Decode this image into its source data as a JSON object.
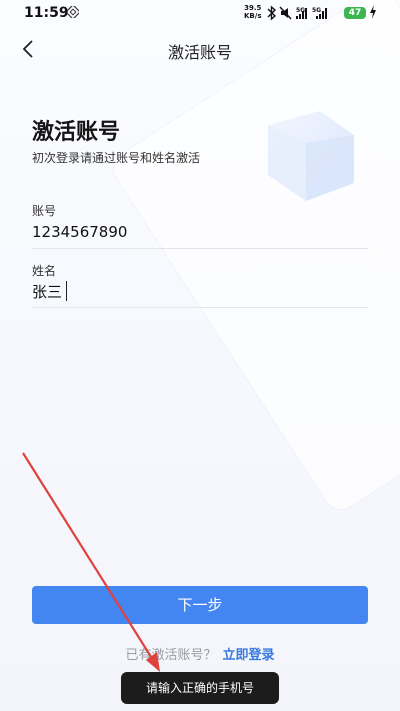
{
  "status_bar": {
    "time": "11:59",
    "speed_value": "39.5",
    "speed_unit": "KB/s",
    "network_1": "5G",
    "network_2": "5G",
    "battery": "47",
    "battery_color": "#3db551"
  },
  "header": {
    "title": "激活账号",
    "back_icon": "chevron-left-icon"
  },
  "main": {
    "title": "激活账号",
    "subtitle": "初次登录请通过账号和姓名激活",
    "account": {
      "label": "账号",
      "value": "1234567890"
    },
    "name": {
      "label": "姓名",
      "value": "张三"
    },
    "next_button": "下一步",
    "login_question": "已有激活账号？",
    "login_link": "立即登录"
  },
  "toast": {
    "text": "请输入正确的手机号"
  },
  "colors": {
    "primary": "#4386f2",
    "link": "#3a7ae0",
    "annotation_arrow": "#e0413a"
  }
}
